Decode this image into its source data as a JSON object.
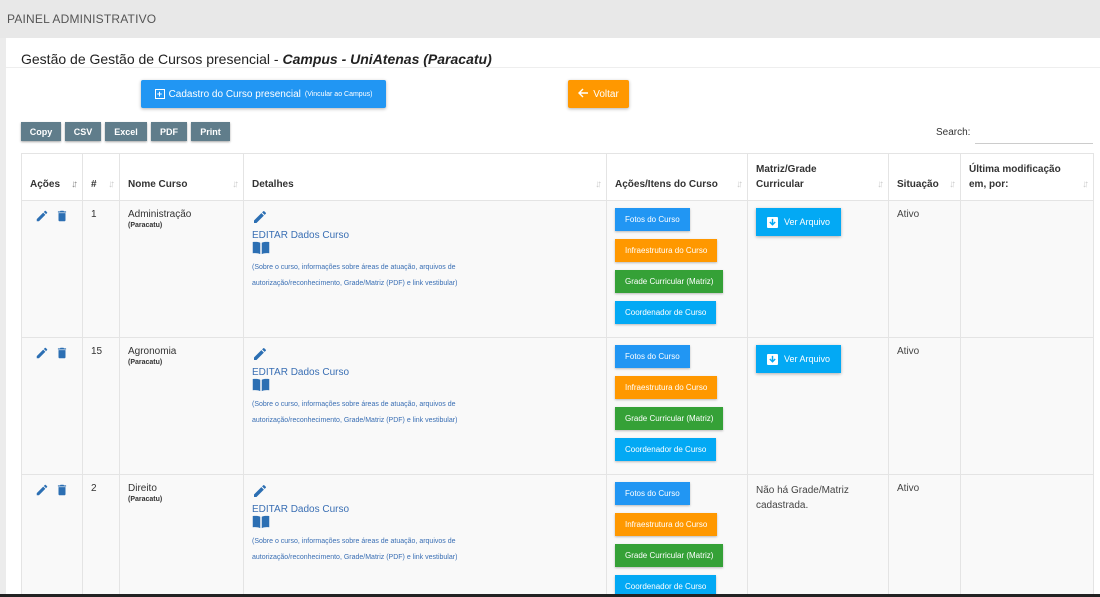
{
  "header": {
    "title": "PAINEL ADMINISTRATIVO"
  },
  "card": {
    "title_prefix": "Gestão de Gestão de Cursos presencial - ",
    "title_campus": "Campus - UniAtenas (Paracatu)"
  },
  "toolbar": {
    "cadastro_label": "Cadastro do Curso presencial",
    "cadastro_sub": "(Vincular ao Campus)",
    "voltar_label": "Voltar"
  },
  "export_buttons": [
    "Copy",
    "CSV",
    "Excel",
    "PDF",
    "Print"
  ],
  "search": {
    "label": "Search:",
    "value": "",
    "placeholder": ""
  },
  "table": {
    "headers": {
      "acoes": "Ações",
      "num": "#",
      "nome": "Nome Curso",
      "detalhes": "Detalhes",
      "itens": "Ações/Itens do Curso",
      "matriz_1": "Matriz/Grade",
      "matriz_2": "Curricular",
      "situacao": "Situação",
      "ultima_1": "Última modificação",
      "ultima_2": "em, por:"
    },
    "detail_link": "EDITAR Dados Curso",
    "detail_desc_1": "(Sobre o curso, informações sobre áreas de atuação, arquivos de",
    "detail_desc_2": "autorização/reconhecimento, Grade/Matriz (PDF) e link vestibular)",
    "item_buttons": {
      "fotos": "Fotos do Curso",
      "infra": "Infraestrutura do Curso",
      "grade": "Grade Curricular (Matriz)",
      "coord": "Coordenador de Curso"
    },
    "ver_arquivo": "Ver Arquivo",
    "no_grade_1": "Não há Grade/Matriz",
    "no_grade_2": "cadastrada.",
    "rows": [
      {
        "id": "1",
        "name": "Administração",
        "campus": "(Paracatu)",
        "status": "Ativo",
        "last_modified": ""
      },
      {
        "id": "15",
        "name": "Agronomia",
        "campus": "(Paracatu)",
        "status": "Ativo",
        "last_modified": ""
      },
      {
        "id": "2",
        "name": "Direito",
        "campus": "(Paracatu)",
        "status": "Ativo",
        "last_modified": ""
      }
    ]
  },
  "colors": {
    "primary": "#2196f3",
    "warning": "#ff9800",
    "success": "#35a137",
    "info": "#03a9f4",
    "export_bg": "#607d8b",
    "icon": "#2c6fb3",
    "link": "#3a6fb4"
  }
}
